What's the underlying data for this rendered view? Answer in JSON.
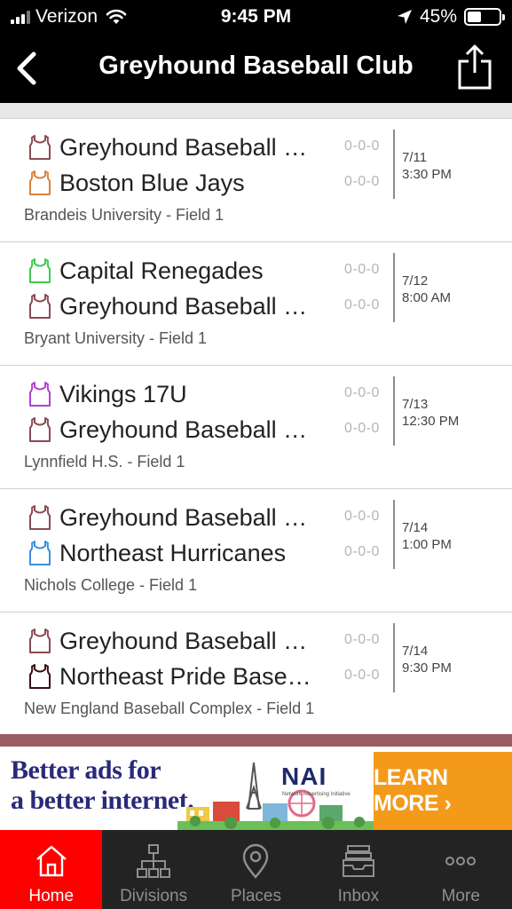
{
  "status_bar": {
    "carrier": "Verizon",
    "time": "9:45 PM",
    "battery_percent": "45%",
    "battery_level": 0.45
  },
  "nav": {
    "title": "Greyhound Baseball Club",
    "back_icon": "chevron-left-icon",
    "share_icon": "share-icon"
  },
  "colors": {
    "accent": "#fe0000",
    "maroon": "#9b5b63",
    "jersey_greyhound": "#8a4b52",
    "jersey_boston": "#d9823a",
    "jersey_capital": "#3fc94e",
    "jersey_vikings": "#b23fd6",
    "jersey_hurricanes": "#3a8fe0",
    "jersey_pride": "#3a0e14"
  },
  "games": [
    {
      "team1": "Greyhound Baseball Club",
      "team1_color": "#8a4b52",
      "team1_score": "0-0-0",
      "team2": "Boston Blue Jays",
      "team2_color": "#d9823a",
      "team2_score": "0-0-0",
      "date": "7/11",
      "time": "3:30 PM",
      "location": "Brandeis University - Field 1"
    },
    {
      "team1": "Capital Renegades",
      "team1_color": "#3fc94e",
      "team1_score": "0-0-0",
      "team2": "Greyhound Baseball Club",
      "team2_color": "#8a4b52",
      "team2_score": "0-0-0",
      "date": "7/12",
      "time": "8:00 AM",
      "location": "Bryant University - Field 1"
    },
    {
      "team1": "Vikings 17U",
      "team1_color": "#b23fd6",
      "team1_score": "0-0-0",
      "team2": "Greyhound Baseball Club",
      "team2_color": "#8a4b52",
      "team2_score": "0-0-0",
      "date": "7/13",
      "time": "12:30 PM",
      "location": "Lynnfield H.S. - Field 1"
    },
    {
      "team1": "Greyhound Baseball Club",
      "team1_color": "#8a4b52",
      "team1_score": "0-0-0",
      "team2": "Northeast Hurricanes",
      "team2_color": "#3a8fe0",
      "team2_score": "0-0-0",
      "date": "7/14",
      "time": "1:00 PM",
      "location": "Nichols College - Field 1"
    },
    {
      "team1": "Greyhound Baseball Club",
      "team1_color": "#8a4b52",
      "team1_score": "0-0-0",
      "team2": "Northeast Pride Baseball",
      "team2_color": "#3a0e14",
      "team2_score": "0-0-0",
      "date": "7/14",
      "time": "9:30 PM",
      "location": "New England Baseball Complex - Field 1"
    }
  ],
  "ad": {
    "headline_line1": "Better ads for",
    "headline_line2": "a better internet.",
    "logo": "NAI",
    "logo_sub": "Network Advertising Initiative",
    "cta": "LEARN MORE ›"
  },
  "tabs": [
    {
      "label": "Home",
      "icon": "home-icon",
      "active": true
    },
    {
      "label": "Divisions",
      "icon": "hierarchy-icon",
      "active": false
    },
    {
      "label": "Places",
      "icon": "map-pin-icon",
      "active": false
    },
    {
      "label": "Inbox",
      "icon": "inbox-icon",
      "active": false
    },
    {
      "label": "More",
      "icon": "more-icon",
      "active": false
    }
  ]
}
